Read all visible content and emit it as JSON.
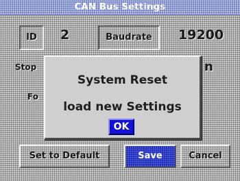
{
  "titlebar": {
    "text": "CAN Bus Settings"
  },
  "fields": {
    "id": {
      "label": "ID",
      "value": "2"
    },
    "baudrate": {
      "label": "Baudrate",
      "value": "19200"
    },
    "stop": {
      "label": "Stop",
      "value": "n"
    },
    "format": {
      "label": "Fo"
    }
  },
  "buttons": {
    "set_default": "Set to Default",
    "save": "Save",
    "cancel": "Cancel"
  },
  "dialog": {
    "title": "System Reset",
    "message": "load new Settings",
    "ok_label": "OK"
  },
  "colors": {
    "titlebar": "#6f7fc4",
    "primary_button": "#1f2dbd",
    "ok_button": "#1111d6",
    "background": "#cdcdcd"
  }
}
